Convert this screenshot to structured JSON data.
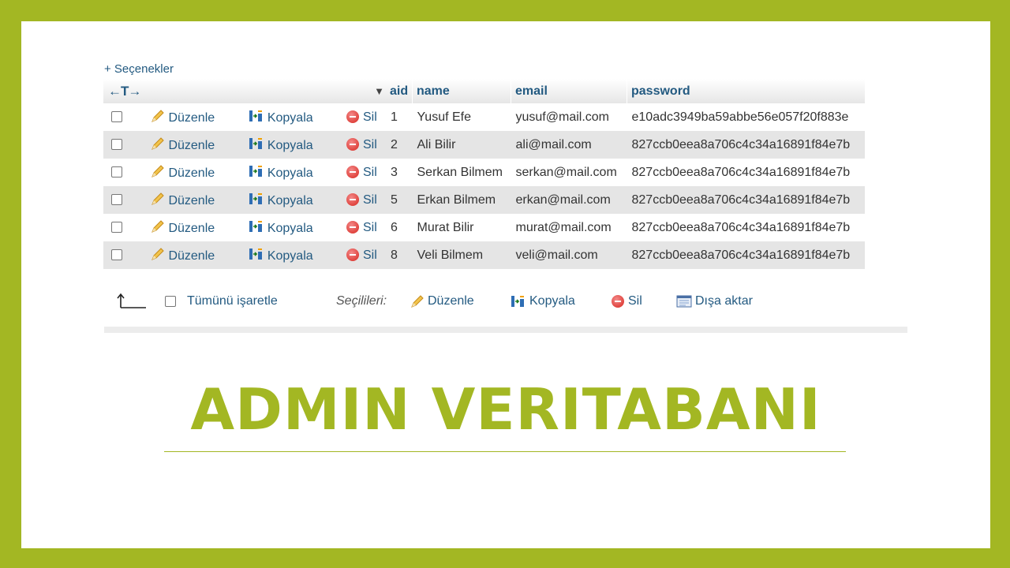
{
  "options_link": "+ Seçenekler",
  "table": {
    "header": {
      "arrows": "←T→",
      "sort_indicator": "▼",
      "columns": [
        "aid",
        "name",
        "email",
        "password"
      ]
    },
    "actions": {
      "edit": "Düzenle",
      "copy": "Kopyala",
      "delete": "Sil"
    },
    "rows": [
      {
        "aid": "1",
        "name": "Yusuf Efe",
        "email": "yusuf@mail.com",
        "password": "e10adc3949ba59abbe56e057f20f883e"
      },
      {
        "aid": "2",
        "name": "Ali Bilir",
        "email": "ali@mail.com",
        "password": "827ccb0eea8a706c4c34a16891f84e7b"
      },
      {
        "aid": "3",
        "name": "Serkan Bilmem",
        "email": "serkan@mail.com",
        "password": "827ccb0eea8a706c4c34a16891f84e7b"
      },
      {
        "aid": "5",
        "name": "Erkan Bilmem",
        "email": "erkan@mail.com",
        "password": "827ccb0eea8a706c4c34a16891f84e7b"
      },
      {
        "aid": "6",
        "name": "Murat Bilir",
        "email": "murat@mail.com",
        "password": "827ccb0eea8a706c4c34a16891f84e7b"
      },
      {
        "aid": "8",
        "name": "Veli Bilmem",
        "email": "veli@mail.com",
        "password": "827ccb0eea8a706c4c34a16891f84e7b"
      }
    ]
  },
  "bulk": {
    "check_all": "Tümünü işaretle",
    "with_selected": "Seçilileri:",
    "edit": "Düzenle",
    "copy": "Kopyala",
    "delete": "Sil",
    "export": "Dışa aktar"
  },
  "title": "ADMIN VERITABANI",
  "colors": {
    "frame": "#a3b723",
    "link": "#235a81",
    "row_alt": "#e5e5e5"
  }
}
